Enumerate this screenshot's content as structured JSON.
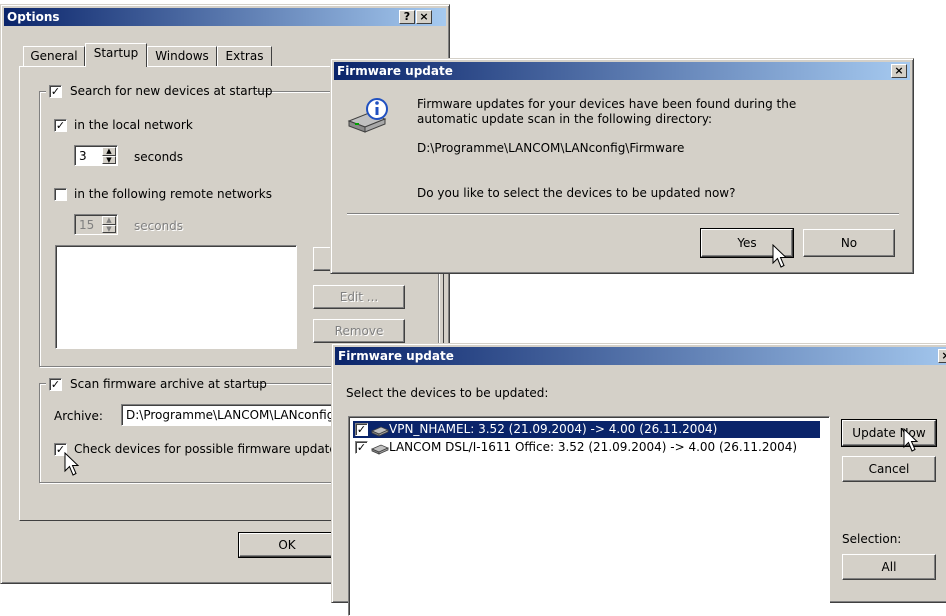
{
  "options": {
    "title": "Options",
    "help_btn": "?",
    "close_btn": "×",
    "tabs": [
      {
        "label": "General"
      },
      {
        "label": "Startup"
      },
      {
        "label": "Windows"
      },
      {
        "label": "Extras"
      }
    ],
    "search_new_devices": {
      "label": "Search for new devices at startup",
      "checked": true
    },
    "local_network": {
      "label": "in the local network",
      "checked": true
    },
    "local_seconds_value": "3",
    "local_seconds_label": "seconds",
    "remote_networks": {
      "label": "in the following remote networks",
      "checked": false
    },
    "remote_seconds_value": "15",
    "remote_seconds_label": "seconds",
    "edit_btn": "Edit ...",
    "remove_btn": "Remove",
    "scan_archive": {
      "label": "Scan firmware archive at startup",
      "checked": true
    },
    "archive_label": "Archive:",
    "archive_value": "D:\\Programme\\LANCOM\\LANconfig\\Firmware",
    "check_devices": {
      "label": "Check devices for possible firmware updates",
      "checked": true
    },
    "ok_btn": "OK"
  },
  "fw_dialog1": {
    "title": "Firmware update",
    "close_btn": "×",
    "message_line1": "Firmware updates for your devices have been found during the",
    "message_line2": "automatic update scan in the following directory:",
    "directory": "D:\\Programme\\LANCOM\\LANconfig\\Firmware",
    "question": "Do you like to select the devices to be updated now?",
    "yes_btn": "Yes",
    "no_btn": "No"
  },
  "fw_dialog2": {
    "title": "Firmware update",
    "close_btn": "×",
    "prompt": "Select the devices to be updated:",
    "devices": [
      {
        "name": "VPN_NHAMEL: 3.52 (21.09.2004) -> 4.00 (26.11.2004)",
        "checked": true,
        "selected": true
      },
      {
        "name": "LANCOM DSL/I-1611 Office: 3.52 (21.09.2004) -> 4.00 (26.11.2004)",
        "checked": true,
        "selected": false
      }
    ],
    "update_now_btn": "Update Now",
    "cancel_btn": "Cancel",
    "selection_label": "Selection:",
    "all_btn": "All"
  }
}
